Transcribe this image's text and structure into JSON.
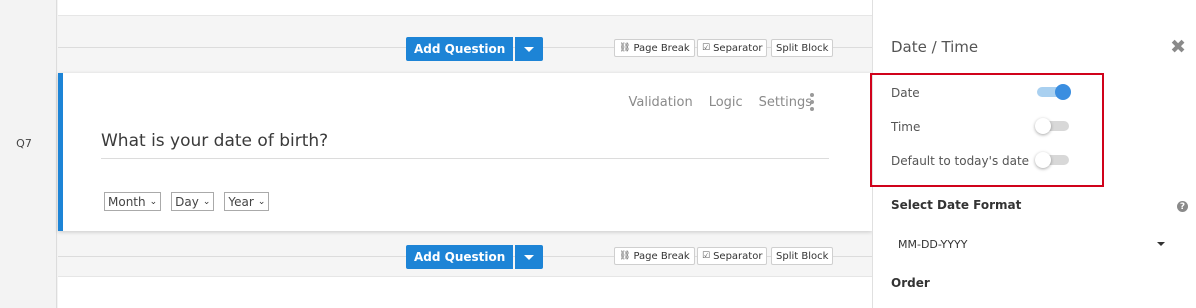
{
  "question": {
    "number": "Q7",
    "text": "What is your date of birth?",
    "tools": {
      "validation": "Validation",
      "logic": "Logic",
      "settings": "Settings"
    },
    "selects": [
      {
        "value": "Month"
      },
      {
        "value": "Day"
      },
      {
        "value": "Year"
      }
    ]
  },
  "toolbar": {
    "add_question": "Add Question",
    "page_break": "Page Break",
    "separator": "Separator",
    "split_block": "Split Block"
  },
  "panel": {
    "title": "Date / Time",
    "options": [
      {
        "label": "Date",
        "enabled": true
      },
      {
        "label": "Time",
        "enabled": false
      },
      {
        "label": "Default to today's date",
        "enabled": false
      }
    ],
    "select_date_format_label": "Select Date Format",
    "date_format_value": "MM-DD-YYYY",
    "order_label": "Order",
    "help_glyph": "?",
    "close_glyph": "✖"
  },
  "colors": {
    "accent": "#1d84d6",
    "highlight_box": "#d0021b",
    "toggle_on": "#3b8ee0"
  }
}
